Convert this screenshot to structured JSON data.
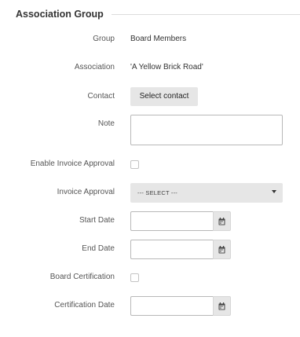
{
  "section": {
    "title": "Association Group"
  },
  "fields": {
    "group": {
      "label": "Group",
      "value": "Board Members"
    },
    "association": {
      "label": "Association",
      "value": "'A Yellow Brick Road'"
    },
    "contact": {
      "label": "Contact",
      "button_label": "Select contact"
    },
    "note": {
      "label": "Note",
      "value": ""
    },
    "enable_invoice_approval": {
      "label": "Enable Invoice Approval",
      "checked": false
    },
    "invoice_approval": {
      "label": "Invoice Approval",
      "selected": "--- SELECT ---"
    },
    "start_date": {
      "label": "Start Date",
      "value": "",
      "icon": "calendar-icon"
    },
    "end_date": {
      "label": "End Date",
      "value": "",
      "icon": "calendar-icon"
    },
    "board_certification": {
      "label": "Board Certification",
      "checked": false
    },
    "certification_date": {
      "label": "Certification Date",
      "value": "",
      "icon": "calendar-icon"
    }
  },
  "colors": {
    "control_bg": "#e6e6e6",
    "border": "#b8b8b8",
    "label": "#555555",
    "rule": "#dcdcdc"
  }
}
